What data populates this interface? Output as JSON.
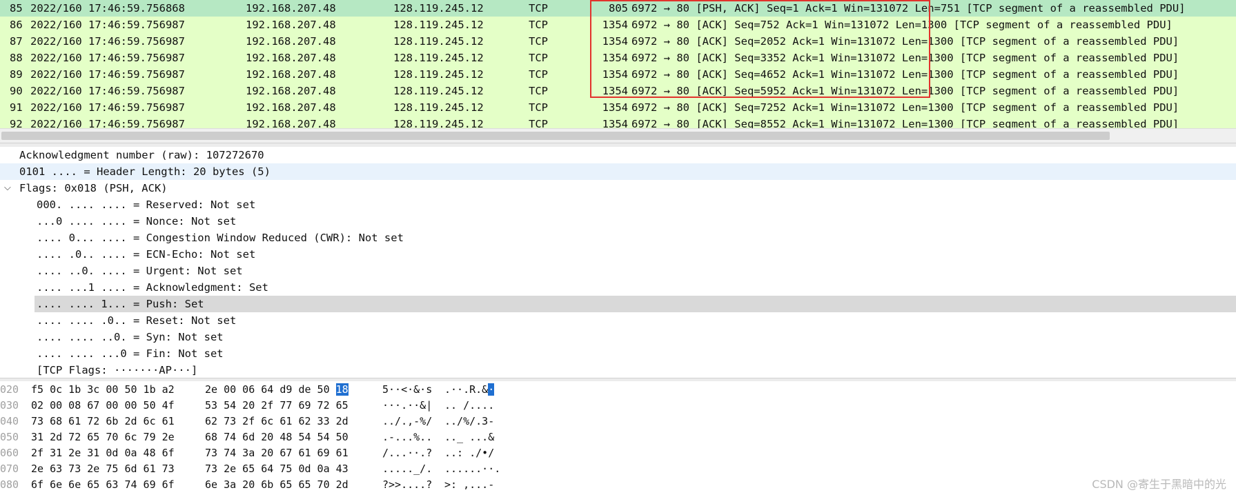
{
  "packet_list": {
    "rows": [
      {
        "no": "85",
        "time": "2022/160 17:46:59.756868",
        "src": "192.168.207.48",
        "dst": "128.119.245.12",
        "proto": "TCP",
        "len": "805",
        "info": "6972 → 80 [PSH, ACK] Seq=1 Ack=1 Win=131072 Len=751 [TCP segment of a reassembled PDU]"
      },
      {
        "no": "86",
        "time": "2022/160 17:46:59.756987",
        "src": "192.168.207.48",
        "dst": "128.119.245.12",
        "proto": "TCP",
        "len": "1354",
        "info": "6972 → 80 [ACK] Seq=752 Ack=1 Win=131072 Len=1300 [TCP segment of a reassembled PDU]"
      },
      {
        "no": "87",
        "time": "2022/160 17:46:59.756987",
        "src": "192.168.207.48",
        "dst": "128.119.245.12",
        "proto": "TCP",
        "len": "1354",
        "info": "6972 → 80 [ACK] Seq=2052 Ack=1 Win=131072 Len=1300 [TCP segment of a reassembled PDU]"
      },
      {
        "no": "88",
        "time": "2022/160 17:46:59.756987",
        "src": "192.168.207.48",
        "dst": "128.119.245.12",
        "proto": "TCP",
        "len": "1354",
        "info": "6972 → 80 [ACK] Seq=3352 Ack=1 Win=131072 Len=1300 [TCP segment of a reassembled PDU]"
      },
      {
        "no": "89",
        "time": "2022/160 17:46:59.756987",
        "src": "192.168.207.48",
        "dst": "128.119.245.12",
        "proto": "TCP",
        "len": "1354",
        "info": "6972 → 80 [ACK] Seq=4652 Ack=1 Win=131072 Len=1300 [TCP segment of a reassembled PDU]"
      },
      {
        "no": "90",
        "time": "2022/160 17:46:59.756987",
        "src": "192.168.207.48",
        "dst": "128.119.245.12",
        "proto": "TCP",
        "len": "1354",
        "info": "6972 → 80 [ACK] Seq=5952 Ack=1 Win=131072 Len=1300 [TCP segment of a reassembled PDU]"
      },
      {
        "no": "91",
        "time": "2022/160 17:46:59.756987",
        "src": "192.168.207.48",
        "dst": "128.119.245.12",
        "proto": "TCP",
        "len": "1354",
        "info": "6972 → 80 [ACK] Seq=7252 Ack=1 Win=131072 Len=1300 [TCP segment of a reassembled PDU]"
      },
      {
        "no": "92",
        "time": "2022/160 17:46:59.756987",
        "src": "192.168.207.48",
        "dst": "128.119.245.12",
        "proto": "TCP",
        "len": "1354",
        "info": "6972 → 80 [ACK] Seq=8552 Ack=1 Win=131072 Len=1300 [TCP segment of a reassembled PDU]"
      }
    ],
    "colors": {
      "row_bg": "#e4ffc7",
      "selected_bg": "#b6e8c3",
      "highlight_box": "#e2322c"
    }
  },
  "details": {
    "lines": [
      {
        "text": "Acknowledgment number (raw): 107272670"
      },
      {
        "text": "0101 .... = Header Length: 20 bytes (5)"
      },
      {
        "text": "Flags: 0x018 (PSH, ACK)",
        "expander": "chevron-down"
      },
      {
        "text": "000. .... .... = Reserved: Not set"
      },
      {
        "text": "...0 .... .... = Nonce: Not set"
      },
      {
        "text": ".... 0... .... = Congestion Window Reduced (CWR): Not set"
      },
      {
        "text": ".... .0.. .... = ECN-Echo: Not set"
      },
      {
        "text": ".... ..0. .... = Urgent: Not set"
      },
      {
        "text": ".... ...1 .... = Acknowledgment: Set"
      },
      {
        "text": ".... .... 1... = Push: Set"
      },
      {
        "text": ".... .... .0.. = Reset: Not set"
      },
      {
        "text": ".... .... ..0. = Syn: Not set"
      },
      {
        "text": ".... .... ...0 = Fin: Not set"
      },
      {
        "text": "[TCP Flags: ·······AP···]"
      }
    ]
  },
  "bytes": {
    "rows": [
      {
        "offset": "020",
        "hex1": "f5 0c 1b 3c 00 50 1b a2",
        "hex2": "2e 00 06 64 d9 de 50",
        "hex2_sel": "18",
        "ascii1": "5··<·&·s",
        "ascii2": ".··.R.&",
        "ascii2_sel": "·"
      },
      {
        "offset": "030",
        "hex1": "02 00 08 67 00 00 50 4f",
        "hex2": "53 54 20 2f 77 69 72 65",
        "ascii1": "···.··&|",
        "ascii2": ".. /...."
      },
      {
        "offset": "040",
        "hex1": "73 68 61 72 6b 2d 6c 61",
        "hex2": "62 73 2f 6c 61 62 33 2d",
        "ascii1": "../.,-%/",
        "ascii2": "../%/.3-"
      },
      {
        "offset": "050",
        "hex1": "31 2d 72 65 70 6c 79 2e",
        "hex2": "68 74 6d 20 48 54 54 50",
        "ascii1": ".-...%..",
        "ascii2": ".._ ...&"
      },
      {
        "offset": "060",
        "hex1": "2f 31 2e 31 0d 0a 48 6f",
        "hex2": "73 74 3a 20 67 61 69 61",
        "ascii1": "/...··.?",
        "ascii2": "..: ./•/"
      },
      {
        "offset": "070",
        "hex1": "2e 63 73 2e 75 6d 61 73",
        "hex2": "73 2e 65 64 75 0d 0a 43",
        "ascii1": "....._/.",
        "ascii2": "......··."
      },
      {
        "offset": "080",
        "hex1": "6f 6e 6e 65 63 74 69 6f",
        "hex2": "6e 3a 20 6b 65 65 70 2d",
        "ascii1": "?>>....?",
        "ascii2": ">: ,...-"
      }
    ],
    "selected_color": "#1f6fd1"
  },
  "watermark": "CSDN @寄生于黑暗中的光"
}
